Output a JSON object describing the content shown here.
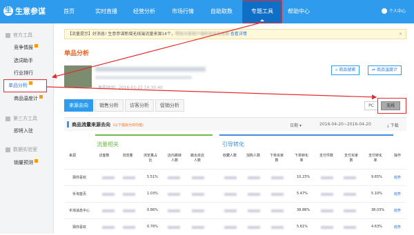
{
  "logo": {
    "mark": "生",
    "text": "生意参谋"
  },
  "nav": {
    "items": [
      "首页",
      "实时直播",
      "经营分析",
      "市场行情",
      "自助取数",
      "专题工具",
      "帮助中心"
    ],
    "user": "个人中心"
  },
  "sidebar": {
    "group1": "官方工具",
    "items1": [
      "竞争情报",
      "选词助手",
      "行业排行",
      "单品分析",
      "商品温度计"
    ],
    "group2": "第三方工具",
    "items2": [
      "即将入驻"
    ],
    "group3": "数据实验室",
    "items3": [
      "销量预测"
    ]
  },
  "notice": {
    "prefix": "【流量提示】好消息! 生意参谋新增无线端流量来源14个，",
    "hidden": "帮助大家商户端和淘宝宝来源",
    "link": "查看详情",
    "close": "×"
  },
  "page_title": "单品分析",
  "buttons": {
    "search": "商品搜索",
    "thermo": "商品温度计"
  },
  "product": {
    "time": "发布时间：2016-01-22 10:30:40"
  },
  "tabs": [
    "来源去向",
    "销售分析",
    "访客分析",
    "促销分析"
  ],
  "device": {
    "pc": "PC",
    "wireless": "无线"
  },
  "section": {
    "title": "商品流量来源去向",
    "sub": "(以下指标为日均值)",
    "date_label": "日期",
    "date_range": "2016-04-20~2016-04-20",
    "download": "下载"
  },
  "groups": {
    "g1": "流量相关",
    "g2": "引导转化"
  },
  "columns": [
    "来源",
    "访客数",
    "浏览量",
    "浏览量占比",
    "店内跳转人数",
    "跳出本店人数",
    "收藏人数",
    "加购人数",
    "下单买家数",
    "下单转化率",
    "支付件数",
    "支付买家数",
    "支付转化率",
    "操作"
  ],
  "rows": [
    {
      "source": "猜你喜欢",
      "share": "5.51%",
      "order_rate": "10.23%",
      "pay_rate": "9.65%",
      "action": "趋势"
    },
    {
      "source": "手淘首页",
      "share": "1.03%",
      "order_rate": "5.47%",
      "pay_rate": "5.10%",
      "action": "趋势"
    },
    {
      "source": "手淘消息中心",
      "share": "0.86%",
      "order_rate": "38.88%",
      "pay_rate": "38.03%",
      "action": "趋势"
    },
    {
      "source": "猜你喜欢",
      "share": "0.76%",
      "order_rate": "5.61%",
      "pay_rate": "4.63%",
      "action": "趋势"
    }
  ],
  "colors": {
    "accent": "#2f9bec",
    "nav_active": "#0f6ec6",
    "title": "#e5601f",
    "annotation": "#e52b2b",
    "green": "#73b745",
    "blue": "#3c8ddb"
  }
}
